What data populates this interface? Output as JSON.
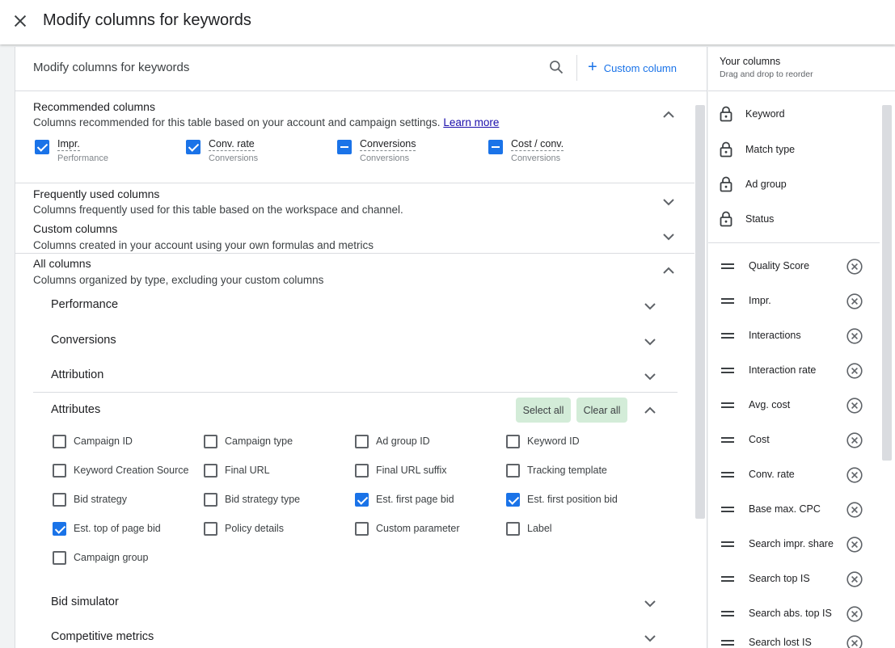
{
  "dialog": {
    "title": "Modify columns for keywords"
  },
  "header": {
    "title": "Modify columns for keywords",
    "custom_column_label": "Custom column"
  },
  "recommended": {
    "title": "Recommended columns",
    "subtitle": "Columns recommended for this table based on your account and campaign settings.",
    "learn_more": "Learn more",
    "items": [
      {
        "label": "Impr.",
        "category": "Performance",
        "state": "checked"
      },
      {
        "label": "Conv. rate",
        "category": "Conversions",
        "state": "checked"
      },
      {
        "label": "Conversions",
        "category": "Conversions",
        "state": "indeterminate"
      },
      {
        "label": "Cost / conv.",
        "category": "Conversions",
        "state": "indeterminate"
      }
    ]
  },
  "frequent": {
    "title": "Frequently used columns",
    "subtitle": "Columns frequently used for this table based on the workspace and channel."
  },
  "custom": {
    "title": "Custom columns",
    "subtitle": "Columns created in your account using your own formulas and metrics"
  },
  "all": {
    "title": "All columns",
    "subtitle": "Columns organized by type, excluding your custom columns",
    "groups": [
      "Performance",
      "Conversions",
      "Attribution"
    ],
    "attributes": {
      "title": "Attributes",
      "select_all": "Select all",
      "clear_all": "Clear all",
      "items": [
        {
          "label": "Campaign ID",
          "checked": false
        },
        {
          "label": "Campaign type",
          "checked": false
        },
        {
          "label": "Ad group ID",
          "checked": false
        },
        {
          "label": "Keyword ID",
          "checked": false
        },
        {
          "label": "Keyword Creation Source",
          "checked": false
        },
        {
          "label": "Final URL",
          "checked": false
        },
        {
          "label": "Final URL suffix",
          "checked": false
        },
        {
          "label": "Tracking template",
          "checked": false
        },
        {
          "label": "Bid strategy",
          "checked": false
        },
        {
          "label": "Bid strategy type",
          "checked": false
        },
        {
          "label": "Est. first page bid",
          "checked": true
        },
        {
          "label": "Est. first position bid",
          "checked": true
        },
        {
          "label": "Est. top of page bid",
          "checked": true
        },
        {
          "label": "Policy details",
          "checked": false
        },
        {
          "label": "Custom parameter",
          "checked": false
        },
        {
          "label": "Label",
          "checked": false
        },
        {
          "label": "Campaign group",
          "checked": false
        }
      ]
    },
    "more_groups": [
      "Bid simulator",
      "Competitive metrics"
    ]
  },
  "your_columns": {
    "title": "Your columns",
    "subtitle": "Drag and drop to reorder",
    "locked": [
      "Keyword",
      "Match type",
      "Ad group",
      "Status"
    ],
    "movable": [
      "Quality Score",
      "Impr.",
      "Interactions",
      "Interaction rate",
      "Avg. cost",
      "Cost",
      "Conv. rate",
      "Base max. CPC",
      "Search impr. share",
      "Search top IS",
      "Search abs. top IS",
      "Search lost IS"
    ]
  },
  "colors": {
    "accent": "#1a73e8",
    "pill": "#d3ecd8",
    "divider": "#dadce0"
  }
}
